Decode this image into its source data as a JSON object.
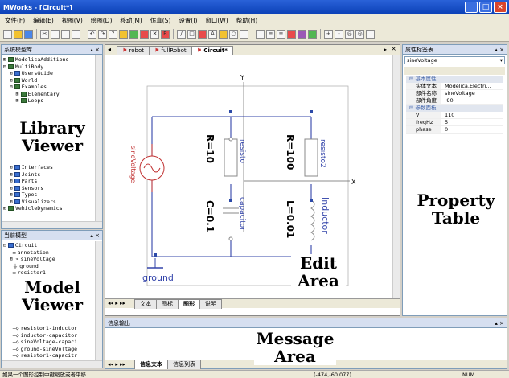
{
  "window": {
    "title": "MWorks - [Circuit*]"
  },
  "menu": [
    "文件(F)",
    "编辑(E)",
    "视图(V)",
    "绘图(D)",
    "移动(M)",
    "仿真(S)",
    "设置(I)",
    "窗口(W)",
    "帮助(H)"
  ],
  "library": {
    "title": "系统模型库",
    "items": [
      "ModelicaAdditions",
      "MultiBody",
      "UsersGuide",
      "World",
      "Examples",
      "Elementary",
      "Loops",
      "Interfaces",
      "Joints",
      "Parts",
      "Sensors",
      "Types",
      "Visualizers",
      "VehicleDynamics"
    ]
  },
  "model_viewer": {
    "title": "当前模型",
    "items": [
      "Circuit",
      "annotation",
      "sineVoltage",
      "ground",
      "resistor1",
      "resistor1-inductor",
      "inductor-capacitor",
      "sineVoltage-capaci",
      "ground-sineVoltage",
      "resistor1-capacitr"
    ]
  },
  "tabs": [
    "robot",
    "fullRobot",
    "Circuit*"
  ],
  "bottom_tabs": [
    "文本",
    "图标",
    "图形",
    "说明"
  ],
  "message_tabs": [
    "信息文本",
    "信息列表"
  ],
  "message": {
    "title": "信息输出"
  },
  "property": {
    "title": "属性标签表",
    "selector": "sineVoltage",
    "group1": "基本属性",
    "group2": "参数面板",
    "rows": [
      {
        "k": "实体文本",
        "v": "Modelica.Electri..."
      },
      {
        "k": "部件名称",
        "v": "sineVoltage"
      },
      {
        "k": "部件角度",
        "v": "-90"
      }
    ],
    "params": [
      {
        "k": "V",
        "v": "110"
      },
      {
        "k": "freqHz",
        "v": "5"
      },
      {
        "k": "phase",
        "v": "0"
      }
    ]
  },
  "diagram": {
    "y_label": "Y",
    "x_label": "X",
    "r1_value": "R=10",
    "r1_name": "resisto",
    "r2_value": "R=100",
    "r2_name": "resisto2",
    "c_value": "C=0.1",
    "c_name": "capacitor",
    "l_value": "L=0.01",
    "l_name": "Inductor",
    "source_name": "sineVoltage",
    "ground": "ground"
  },
  "overlay_labels": {
    "library": "Library Viewer",
    "model": "Model Viewer",
    "edit": "Edit Area",
    "property": "Property Table",
    "message": "Message Area"
  },
  "status": {
    "left": "如果一个图形控制中键缩放或者平移",
    "coord": "(-474,-60.077)",
    "num": "NUM"
  }
}
